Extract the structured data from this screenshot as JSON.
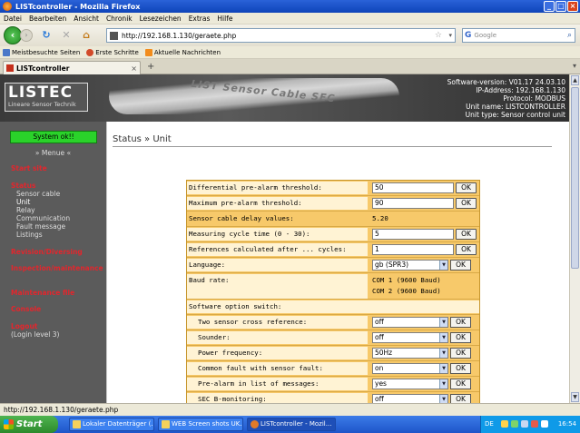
{
  "window": {
    "title": "LISTcontroller - Mozilla Firefox"
  },
  "menubar": [
    "Datei",
    "Bearbeiten",
    "Ansicht",
    "Chronik",
    "Lesezeichen",
    "Extras",
    "Hilfe"
  ],
  "navbar": {
    "url": "http://192.168.1.130/geraete.php",
    "search_placeholder": "Google"
  },
  "bookmarks": [
    "Meistbesuchte Seiten",
    "Erste Schritte",
    "Aktuelle Nachrichten"
  ],
  "tab": {
    "label": "LISTcontroller"
  },
  "header": {
    "logo": "LISTEC",
    "logo_sub": "Lineare Sensor Technik",
    "cable_text": "LIST Sensor Cable SEC",
    "info": [
      "Software-version: V01.17 24.03.10",
      "IP-Address: 192.168.1.130",
      "Protocol: MODBUS",
      "Unit name: LISTCONTROLLER",
      "Unit type: Sensor control unit"
    ]
  },
  "sidebar": {
    "status_button": "System ok!!",
    "menu_label": "» Menue «",
    "start": "Start site",
    "status": "Status",
    "status_subs": [
      "Sensor cable",
      "Unit",
      "Relay",
      "Communication",
      "Fault message",
      "Listings"
    ],
    "revision": "Revision/Diversing",
    "inspection": "Inspection/maintenance",
    "maintenance_file": "Maintenance file",
    "console": "Console",
    "logout": "Logout",
    "login_level": "(Login level 3)"
  },
  "content": {
    "heading": "Status » Unit",
    "ok_label": "OK",
    "rows": {
      "diff_pre_alarm": {
        "label": "Differential pre-alarm threshold:",
        "value": "50"
      },
      "max_pre_alarm": {
        "label": "Maximum pre-alarm threshold:",
        "value": "90"
      },
      "cable_delay": {
        "label": "Sensor cable delay values:",
        "value": "5.20"
      },
      "cycle_time": {
        "label": "Measuring cycle time (0 - 30):",
        "value": "5"
      },
      "references": {
        "label": "References calculated after ... cycles:",
        "value": "1"
      },
      "language": {
        "label": "Language:",
        "value": "gb (SPR3)"
      },
      "baud": {
        "label": "Baud rate:",
        "com1": "COM 1 (9600 Baud)",
        "com2": "COM 2 (9600 Baud)"
      },
      "option_switch": {
        "label": "Software option switch:"
      },
      "two_sensor": {
        "label": "Two sensor cross reference:",
        "value": "off"
      },
      "sounder": {
        "label": "Sounder:",
        "value": "off"
      },
      "power_freq": {
        "label": "Power frequency:",
        "value": "50Hz"
      },
      "common_fault": {
        "label": "Common fault with sensor fault:",
        "value": "on"
      },
      "pre_alarm_list": {
        "label": "Pre-alarm in list of messages:",
        "value": "yes"
      },
      "sec_b": {
        "label": "SEC B-monitoring:",
        "value": "off"
      }
    }
  },
  "statusbar": {
    "text": "http://192.168.1.130/geraete.php"
  },
  "taskbar": {
    "start": "Start",
    "tasks": [
      "Lokaler Datenträger (...",
      "WEB Screen shots UK...",
      "LISTcontroller - Mozil..."
    ],
    "lang": "DE",
    "clock": "16:54"
  }
}
